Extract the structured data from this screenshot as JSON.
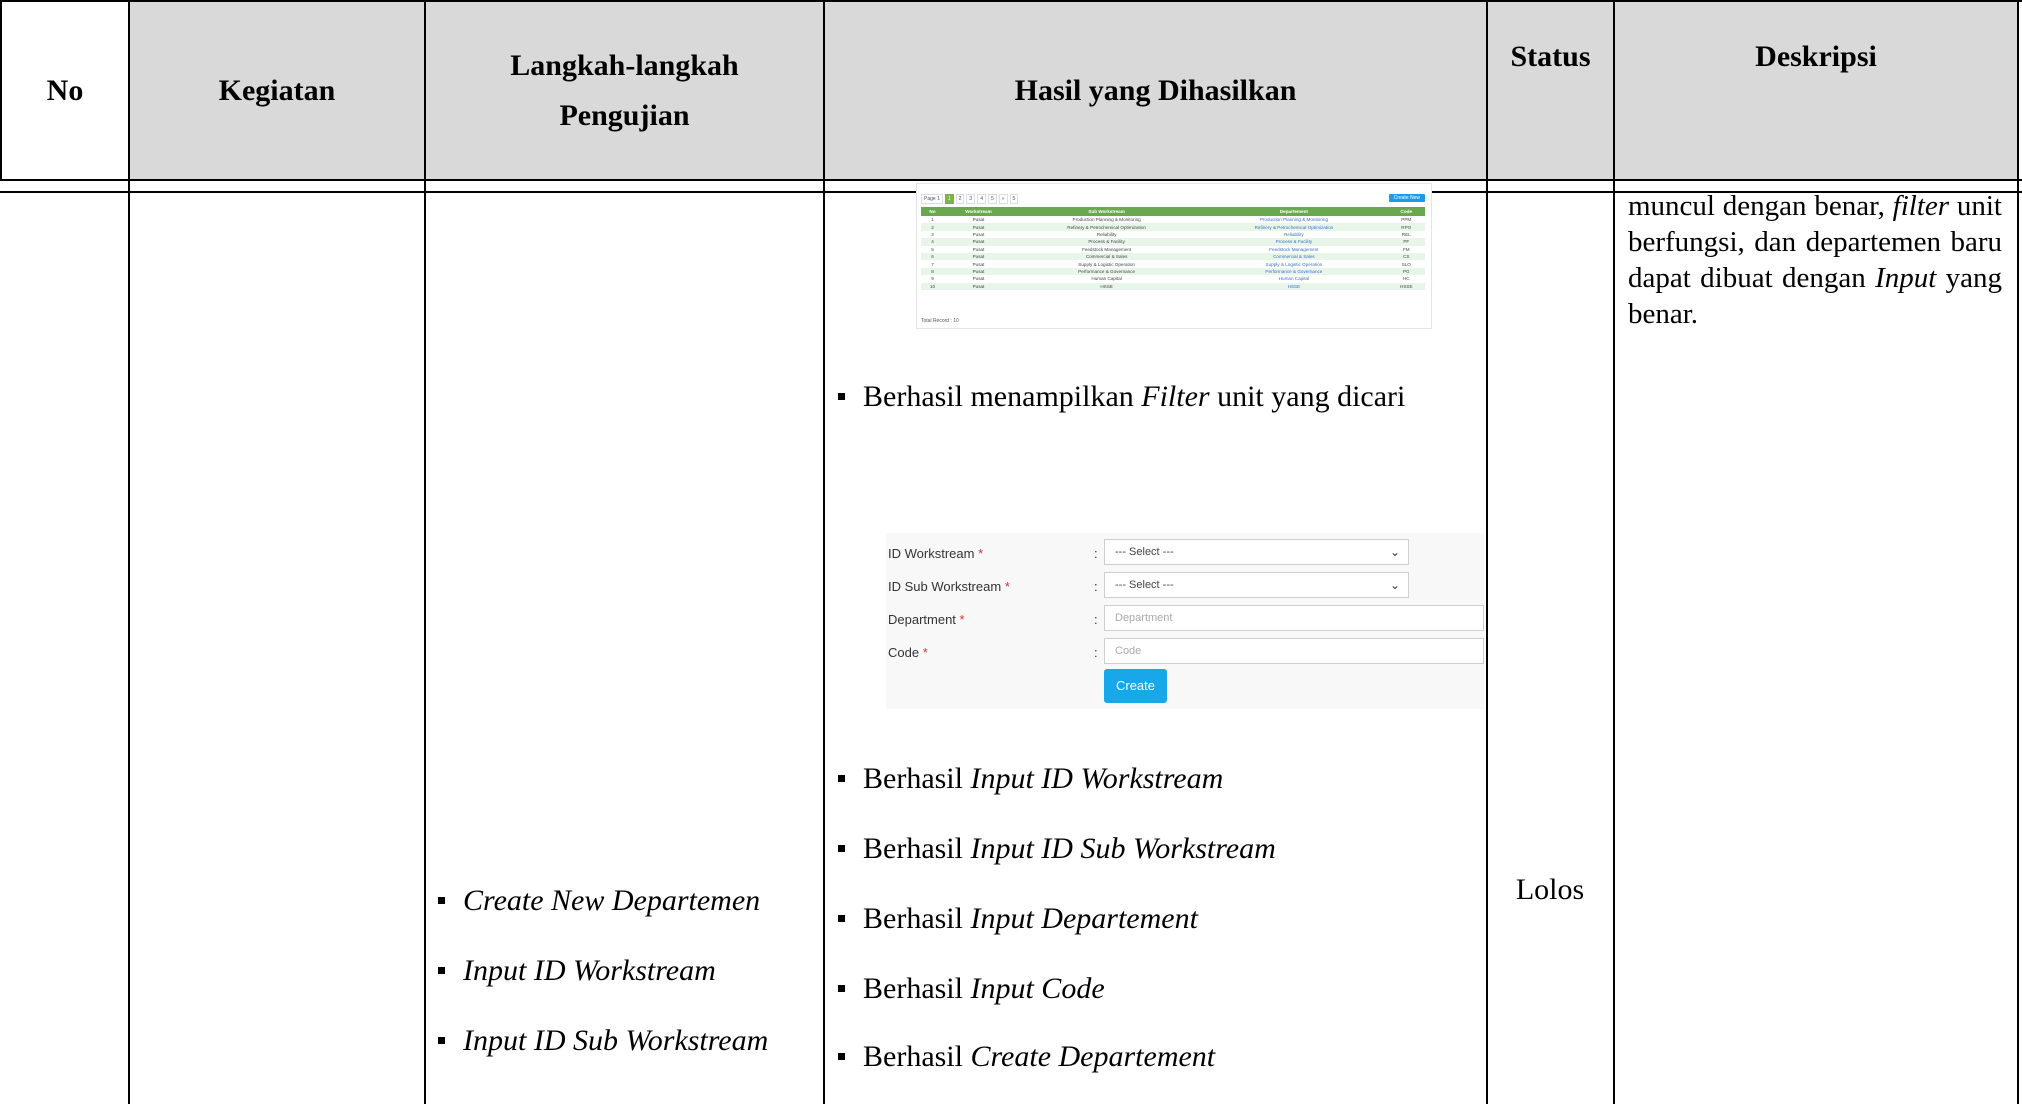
{
  "headers": {
    "no": "No",
    "kegiatan": "Kegiatan",
    "langkah_line1": "Langkah-langkah",
    "langkah_line2": "Pengujian",
    "hasil": "Hasil yang Dihasilkan",
    "status": "Status",
    "deskripsi": "Deskripsi"
  },
  "langkah_items": [
    "Create New Departemen",
    "Input ID Workstream",
    "Input ID Sub Workstream"
  ],
  "hasil": {
    "filter_item_prefix": "Berhasil menampilkan ",
    "filter_item_italic": "Filter",
    "filter_item_suffix": " unit yang dicari",
    "items": [
      {
        "prefix": "Berhasil ",
        "italic": "Input ID Workstream"
      },
      {
        "prefix": "Berhasil ",
        "italic": "Input ID Sub Workstream"
      },
      {
        "prefix": "Berhasil ",
        "italic": "Input Departement"
      },
      {
        "prefix": "Berhasil ",
        "italic": "Input Code"
      },
      {
        "prefix": "Berhasil ",
        "italic": "Create Departement"
      }
    ]
  },
  "status": "Lolos",
  "deskripsi": {
    "t1": "muncul dengan benar, ",
    "i1": "filter",
    "t2": " unit berfungsi, dan departemen baru dapat dibuat dengan ",
    "i2": "Input",
    "t3": " yang benar."
  },
  "screenshot_table": {
    "pager": [
      "Page 1",
      "1",
      "2",
      "3",
      "4",
      "5",
      "»",
      "5"
    ],
    "create_new": "Create New",
    "columns": [
      "No",
      "Workstream",
      "Sub Workstream",
      "Departement",
      "Code"
    ],
    "rows": [
      [
        "1",
        "Pusat",
        "Production Planning & Monitoring",
        "Production Planning & Monitoring",
        "PPM"
      ],
      [
        "2",
        "Pusat",
        "Refinery & Petrochemical Optimization",
        "Refinery & Petrochemical Optimization",
        "RPO"
      ],
      [
        "3",
        "Pusat",
        "Reliability",
        "Reliability",
        "REL"
      ],
      [
        "4",
        "Pusat",
        "Process & Facility",
        "Process & Facility",
        "PF"
      ],
      [
        "5",
        "Pusat",
        "Feedstock Management",
        "Feedstock Management",
        "FM"
      ],
      [
        "6",
        "Pusat",
        "Commercial & Sales",
        "Commercial & Sales",
        "CS"
      ],
      [
        "7",
        "Pusat",
        "Supply & Logistic Operation",
        "Supply & Logistic Operation",
        "SLO"
      ],
      [
        "8",
        "Pusat",
        "Performance & Governance",
        "Performance & Governance",
        "PG"
      ],
      [
        "9",
        "Pusat",
        "Human Capital",
        "Human Capital",
        "HC"
      ],
      [
        "10",
        "Pusat",
        "HSSE",
        "HSSE",
        "HSSE"
      ]
    ],
    "total": "Total Record : 10"
  },
  "screenshot_form": {
    "ws_label": "ID Workstream",
    "sws_label": "ID Sub Workstream",
    "dept_label": "Department",
    "code_label": "Code",
    "req": "*",
    "colon": ":",
    "select_value": "--- Select ---",
    "dept_placeholder": "Department",
    "code_placeholder": "Code",
    "create_button": "Create",
    "chevron_icon": "chevron-down-icon"
  }
}
